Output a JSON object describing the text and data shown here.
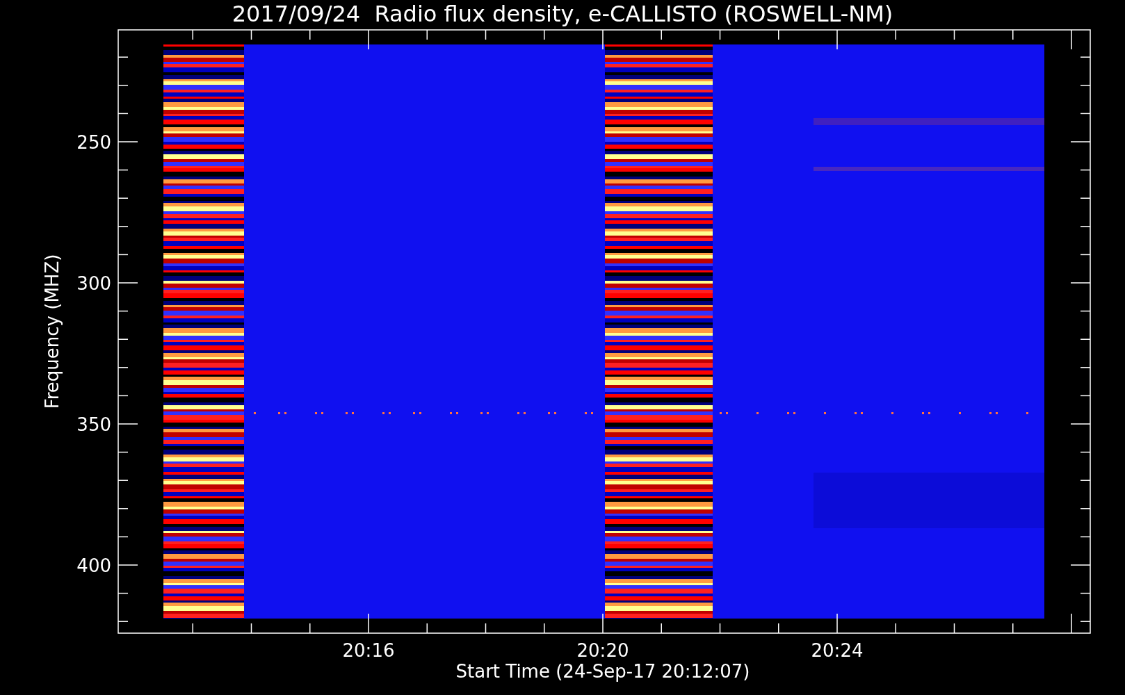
{
  "title": "2017/09/24  Radio flux density, e-CALLISTO (ROSWELL-NM)",
  "y_axis": {
    "label": "Frequency (MHZ)",
    "ticks": [
      "250",
      "300",
      "350",
      "400"
    ]
  },
  "x_axis": {
    "label": "Start Time (24-Sep-17 20:12:07)",
    "ticks": [
      "20:16",
      "20:20",
      "20:24"
    ]
  }
}
